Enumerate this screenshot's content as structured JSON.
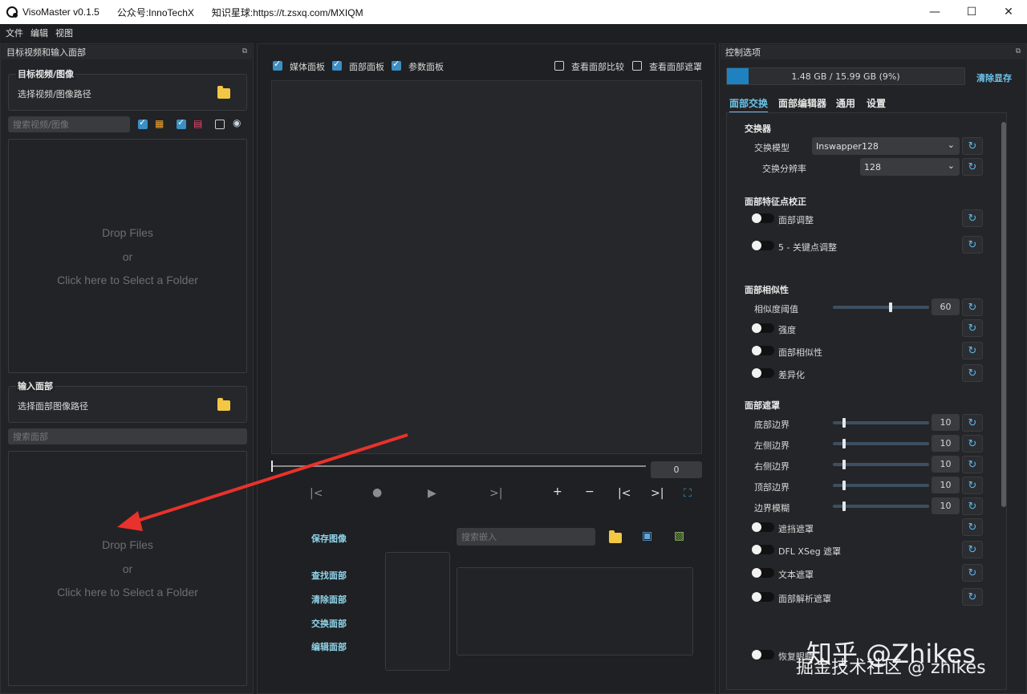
{
  "titlebar": {
    "app_name": "VisoMaster v0.1.5",
    "wechat": "公众号:InnoTechX",
    "planet": "知识星球:https://t.zsxq.com/MXIQM",
    "min": "—",
    "max": "☐",
    "close": "✕"
  },
  "menu": [
    "文件",
    "编辑",
    "视图"
  ],
  "left": {
    "dock_title": "目标视频和输入面部",
    "target_group": "目标视频/图像",
    "select_video_path": "选择视频/图像路径",
    "search_video_placeholder": "搜索视频/图像",
    "drop1": {
      "line1": "Drop Files",
      "line2": "or",
      "line3": "Click here to Select a Folder"
    },
    "input_face_group": "输入面部",
    "select_face_path": "选择面部图像路径",
    "search_face_placeholder": "搜索面部",
    "drop2": {
      "line1": "Drop Files",
      "line2": "or",
      "line3": "Click here to Select a Folder"
    }
  },
  "center": {
    "checks": {
      "media": "媒体面板",
      "face": "面部面板",
      "param": "参数面板",
      "compare": "查看面部比较",
      "mask": "查看面部遮罩"
    },
    "frame_value": "0",
    "save_image": "保存图像",
    "search_embed_placeholder": "搜索嵌入",
    "find_faces": "查找面部",
    "clear_faces": "清除面部",
    "swap_faces": "交换面部",
    "edit_faces": "编辑面部"
  },
  "right": {
    "dock_title": "控制选项",
    "memory": {
      "label": "1.48 GB / 15.99 GB (9%)",
      "percent": 9
    },
    "clear_vram": "清除显存",
    "tabs": [
      "面部交换",
      "面部编辑器",
      "通用",
      "设置"
    ],
    "swapper_section": "交换器",
    "swap_model_label": "交换模型",
    "swap_model_value": "Inswapper128",
    "swap_res_label": "交换分辨率",
    "swap_res_value": "128",
    "landmark_section": "面部特征点校正",
    "face_adjust": "面部调整",
    "kps_adjust": "5 - 关键点调整",
    "similarity_section": "面部相似性",
    "sim_threshold_label": "相似度阈值",
    "sim_threshold_value": "60",
    "strength": "强度",
    "face_similarity": "面部相似性",
    "differencing": "差异化",
    "mask_section": "面部遮罩",
    "bottom_border": "底部边界",
    "left_border": "左侧边界",
    "right_border": "右侧边界",
    "top_border": "顶部边界",
    "border_blur": "边界模糊",
    "border_value": "10",
    "occlusion_mask": "遮挡遮罩",
    "dfl_xseg_mask": "DFL XSeg 遮罩",
    "text_mask": "文本遮罩",
    "face_parser_mask": "面部解析遮罩",
    "restore": "恢复眼睛"
  },
  "watermark": {
    "big": "知乎 @Zhikes",
    "small": "掘金技术社区 @ zhikes"
  }
}
